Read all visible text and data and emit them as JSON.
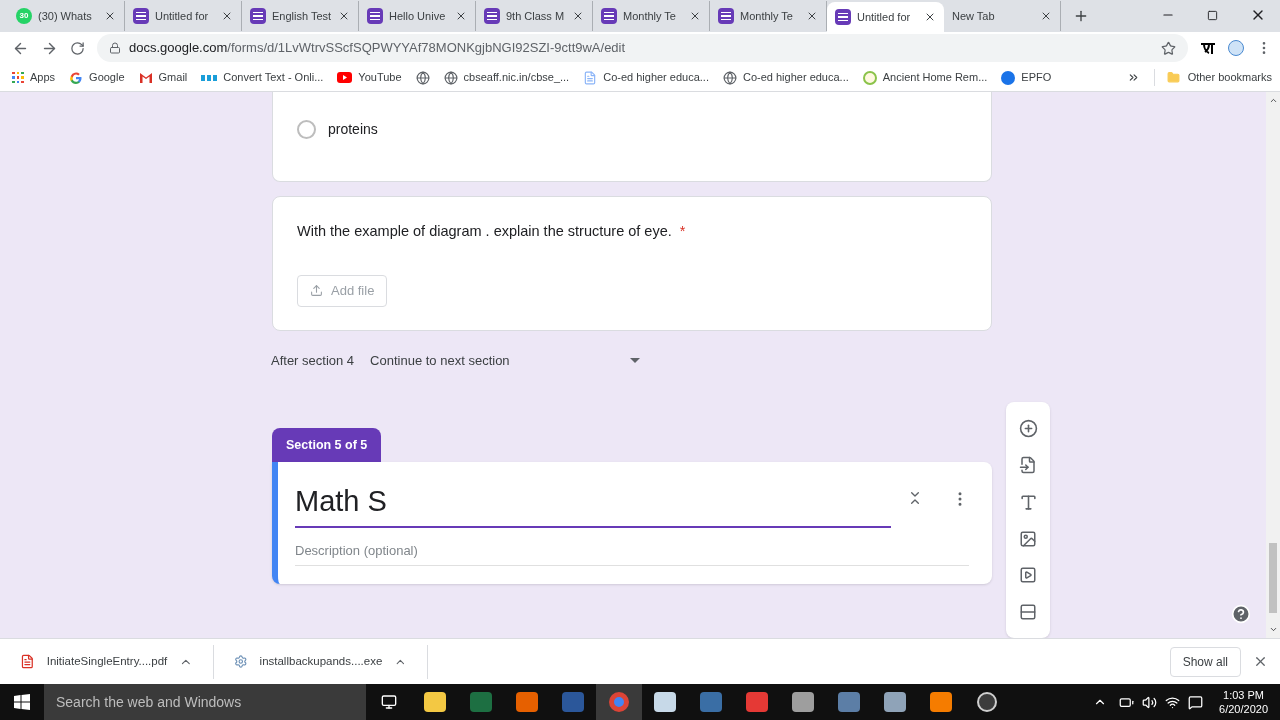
{
  "tabs": [
    {
      "title": "(30) Whats",
      "kind": "chat",
      "badge": "30",
      "selected": false
    },
    {
      "title": "Untitled for",
      "kind": "form",
      "selected": false
    },
    {
      "title": "English Test",
      "kind": "form",
      "selected": false
    },
    {
      "title": "Hello Unive",
      "kind": "form",
      "selected": false
    },
    {
      "title": "9th Class M",
      "kind": "form",
      "selected": false
    },
    {
      "title": "Monthly Te",
      "kind": "form",
      "selected": false
    },
    {
      "title": "Monthly Te",
      "kind": "form",
      "selected": false
    },
    {
      "title": "Untitled for",
      "kind": "form",
      "selected": true
    },
    {
      "title": "New Tab",
      "kind": "blank",
      "selected": false
    }
  ],
  "address": {
    "host": "docs.google.com",
    "path": "/forms/d/1LvWtrvSScfSQPWYYAf78MONKgjbNGI92SZI-9ctt9wA/edit"
  },
  "bookmarks": [
    {
      "label": "Apps",
      "kind": "apps"
    },
    {
      "label": "Google",
      "kind": "google"
    },
    {
      "label": "Gmail",
      "kind": "gmail"
    },
    {
      "label": "Convert Text - Onli...",
      "kind": "pgc"
    },
    {
      "label": "YouTube",
      "kind": "youtube"
    },
    {
      "kind": "globe"
    },
    {
      "label": "cbseaff.nic.in/cbse_...",
      "kind": "globe"
    },
    {
      "label": "Co-ed higher educa...",
      "kind": "doc"
    },
    {
      "label": "Co-ed higher educa...",
      "kind": "globe"
    },
    {
      "label": "Ancient Home Rem...",
      "kind": "leaf"
    },
    {
      "label": "EPFO",
      "kind": "epfo"
    }
  ],
  "other_bookmarks": "Other bookmarks",
  "form": {
    "option": {
      "label": "proteins",
      "selected": false
    },
    "question": {
      "text": "With the example of diagram . explain the structure of eye.",
      "required_mark": "*",
      "button": "Add file"
    },
    "after_section": {
      "label": "After section 4",
      "value": "Continue to next section"
    },
    "section_tab": "Section 5 of 5",
    "section": {
      "title": "Math S",
      "description_placeholder": "Description (optional)"
    }
  },
  "downloads": [
    {
      "name": "InitiateSingleEntry....pdf",
      "kind": "pdf"
    },
    {
      "name": "installbackupands....exe",
      "kind": "exe"
    }
  ],
  "show_all": "Show all",
  "taskbar": {
    "search_placeholder": "Search the web and Windows",
    "time": "1:03 PM",
    "date": "6/20/2020"
  }
}
